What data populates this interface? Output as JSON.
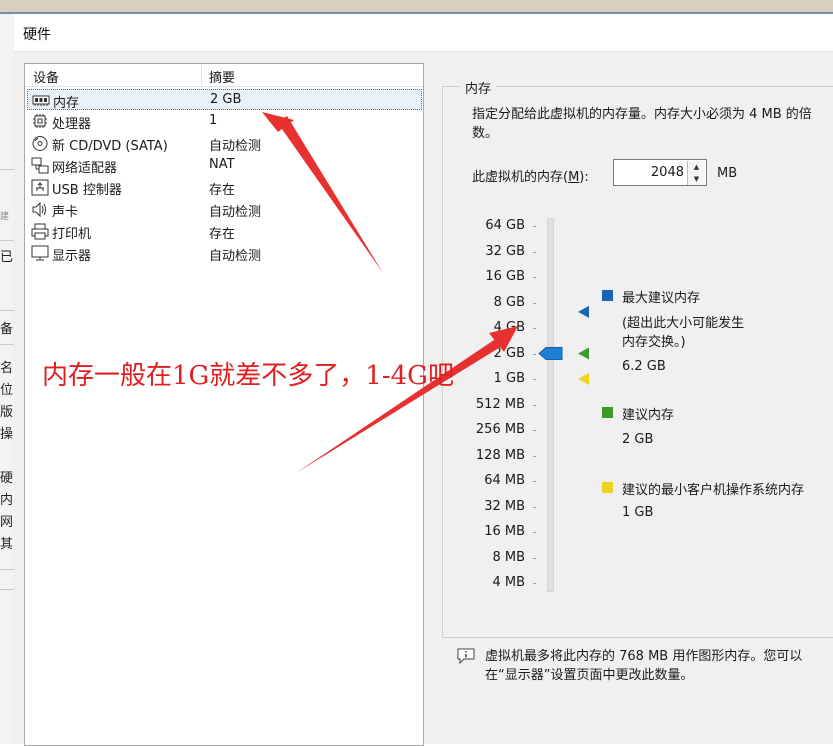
{
  "window": {
    "title": "硬件"
  },
  "ghost_sidebar": {
    "tiny": "建",
    "items": [
      "已",
      "备",
      "名",
      "位",
      "版",
      "操",
      "硬",
      "内",
      "网",
      "其"
    ]
  },
  "device_list": {
    "header": {
      "device": "设备",
      "summary": "摘要"
    },
    "items": [
      {
        "name": "内存",
        "summary": "2 GB",
        "icon": "memory-icon",
        "selected": true
      },
      {
        "name": "处理器",
        "summary": "1",
        "icon": "cpu-icon"
      },
      {
        "name": "新 CD/DVD (SATA)",
        "summary": "自动检测",
        "icon": "cd-dvd-icon"
      },
      {
        "name": "网络适配器",
        "summary": "NAT",
        "icon": "network-adapter-icon"
      },
      {
        "name": "USB 控制器",
        "summary": "存在",
        "icon": "usb-icon"
      },
      {
        "name": "声卡",
        "summary": "自动检测",
        "icon": "speaker-icon"
      },
      {
        "name": "打印机",
        "summary": "存在",
        "icon": "printer-icon"
      },
      {
        "name": "显示器",
        "summary": "自动检测",
        "icon": "monitor-icon"
      }
    ]
  },
  "memory": {
    "group_title": "内存",
    "description": "指定分配给此虚拟机的内存量。内存大小必须为 4 MB 的倍数。",
    "label": "此虚拟机的内存(M):",
    "label_access_key": "M",
    "value": "2048",
    "unit": "MB",
    "scale": [
      "64 GB",
      "32 GB",
      "16 GB",
      "8 GB",
      "4 GB",
      "2 GB",
      "1 GB",
      "512 MB",
      "256 MB",
      "128 MB",
      "64 MB",
      "32 MB",
      "16 MB",
      "8 MB",
      "4 MB"
    ],
    "slider_value": "2 GB",
    "legend": {
      "max": {
        "title": "最大建议内存",
        "note": "(超出此大小可能发生内存交换。)",
        "value": "6.2 GB",
        "color": "#1a64b4"
      },
      "recommended": {
        "title": "建议内存",
        "value": "2 GB",
        "color": "#3c9a2a"
      },
      "min": {
        "title": "建议的最小客户机操作系统内存",
        "value": "1 GB",
        "color": "#f0d020"
      }
    }
  },
  "footer": {
    "note": "虚拟机最多将此内存的 768 MB 用作图形内存。您可以在“显示器”设置页面中更改此数量。"
  },
  "annotation": {
    "text": "内存一般在1G就差不多了，1-4G吧",
    "color": "#e02020"
  }
}
